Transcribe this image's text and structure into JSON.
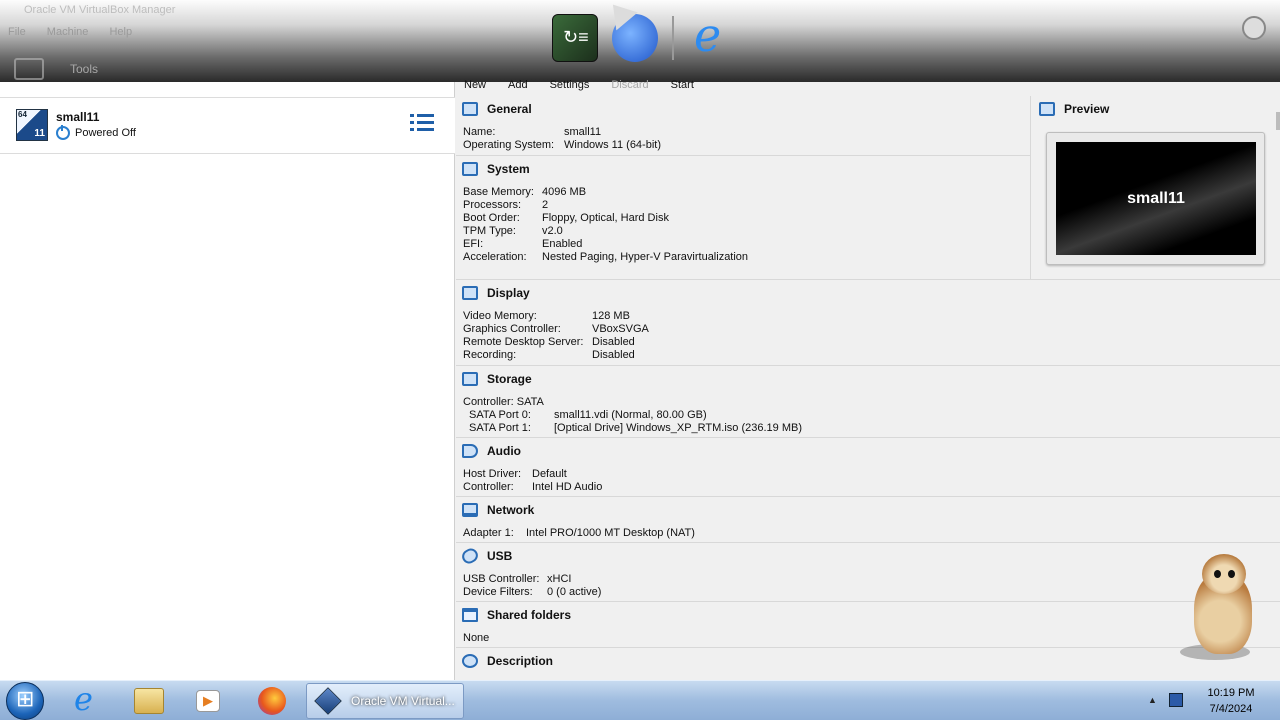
{
  "window": {
    "title": "Oracle VM VirtualBox Manager",
    "menu": [
      "File",
      "Machine",
      "Help"
    ],
    "tools_label": "Tools"
  },
  "toolbar": {
    "new": "New",
    "add": "Add",
    "settings": "Settings",
    "discard": "Discard",
    "start": "Start"
  },
  "vm_list": [
    {
      "name": "small11",
      "state": "Powered Off",
      "badge_64": "64",
      "badge_ver": "11"
    }
  ],
  "details": {
    "general": {
      "title": "General",
      "rows": [
        {
          "k": "Name:",
          "v": "small11"
        },
        {
          "k": "Operating System:",
          "v": "Windows 11 (64-bit)"
        }
      ]
    },
    "system": {
      "title": "System",
      "rows": [
        {
          "k": "Base Memory:",
          "v": "4096 MB"
        },
        {
          "k": "Processors:",
          "v": "2"
        },
        {
          "k": "Boot Order:",
          "v": "Floppy, Optical, Hard Disk"
        },
        {
          "k": "TPM Type:",
          "v": "v2.0"
        },
        {
          "k": "EFI:",
          "v": "Enabled"
        },
        {
          "k": "Acceleration:",
          "v": "Nested Paging, Hyper-V Paravirtualization"
        }
      ]
    },
    "preview": {
      "title": "Preview",
      "screen_text": "small11"
    },
    "display": {
      "title": "Display",
      "rows": [
        {
          "k": "Video Memory:",
          "v": "128 MB"
        },
        {
          "k": "Graphics Controller:",
          "v": "VBoxSVGA"
        },
        {
          "k": "Remote Desktop Server:",
          "v": "Disabled"
        },
        {
          "k": "Recording:",
          "v": "Disabled"
        }
      ]
    },
    "storage": {
      "title": "Storage",
      "rows": [
        {
          "k": "Controller: SATA",
          "v": ""
        },
        {
          "k": "SATA Port 0:",
          "v": "small11.vdi (Normal, 80.00 GB)"
        },
        {
          "k": "SATA Port 1:",
          "v": "[Optical Drive] Windows_XP_RTM.iso (236.19 MB)"
        }
      ]
    },
    "audio": {
      "title": "Audio",
      "rows": [
        {
          "k": "Host Driver:",
          "v": "Default"
        },
        {
          "k": "Controller:",
          "v": "Intel HD Audio"
        }
      ]
    },
    "network": {
      "title": "Network",
      "rows": [
        {
          "k": "Adapter 1:",
          "v": "Intel PRO/1000 MT Desktop (NAT)"
        }
      ]
    },
    "usb": {
      "title": "USB",
      "rows": [
        {
          "k": "USB Controller:",
          "v": "xHCI"
        },
        {
          "k": "Device Filters:",
          "v": "0 (0 active)"
        }
      ]
    },
    "shared": {
      "title": "Shared folders",
      "rows": [
        {
          "k": "None",
          "v": ""
        }
      ]
    },
    "description": {
      "title": "Description"
    }
  },
  "taskbar": {
    "task_label": "Oracle VM Virtual...",
    "time": "10:19 PM",
    "date": "7/4/2024"
  },
  "icons": {
    "start": "windows-start-orb",
    "ie": "internet-explorer-icon",
    "explorer": "file-explorer-icon",
    "media": "media-player-icon",
    "firefox": "firefox-icon",
    "virtualbox": "virtualbox-icon"
  }
}
